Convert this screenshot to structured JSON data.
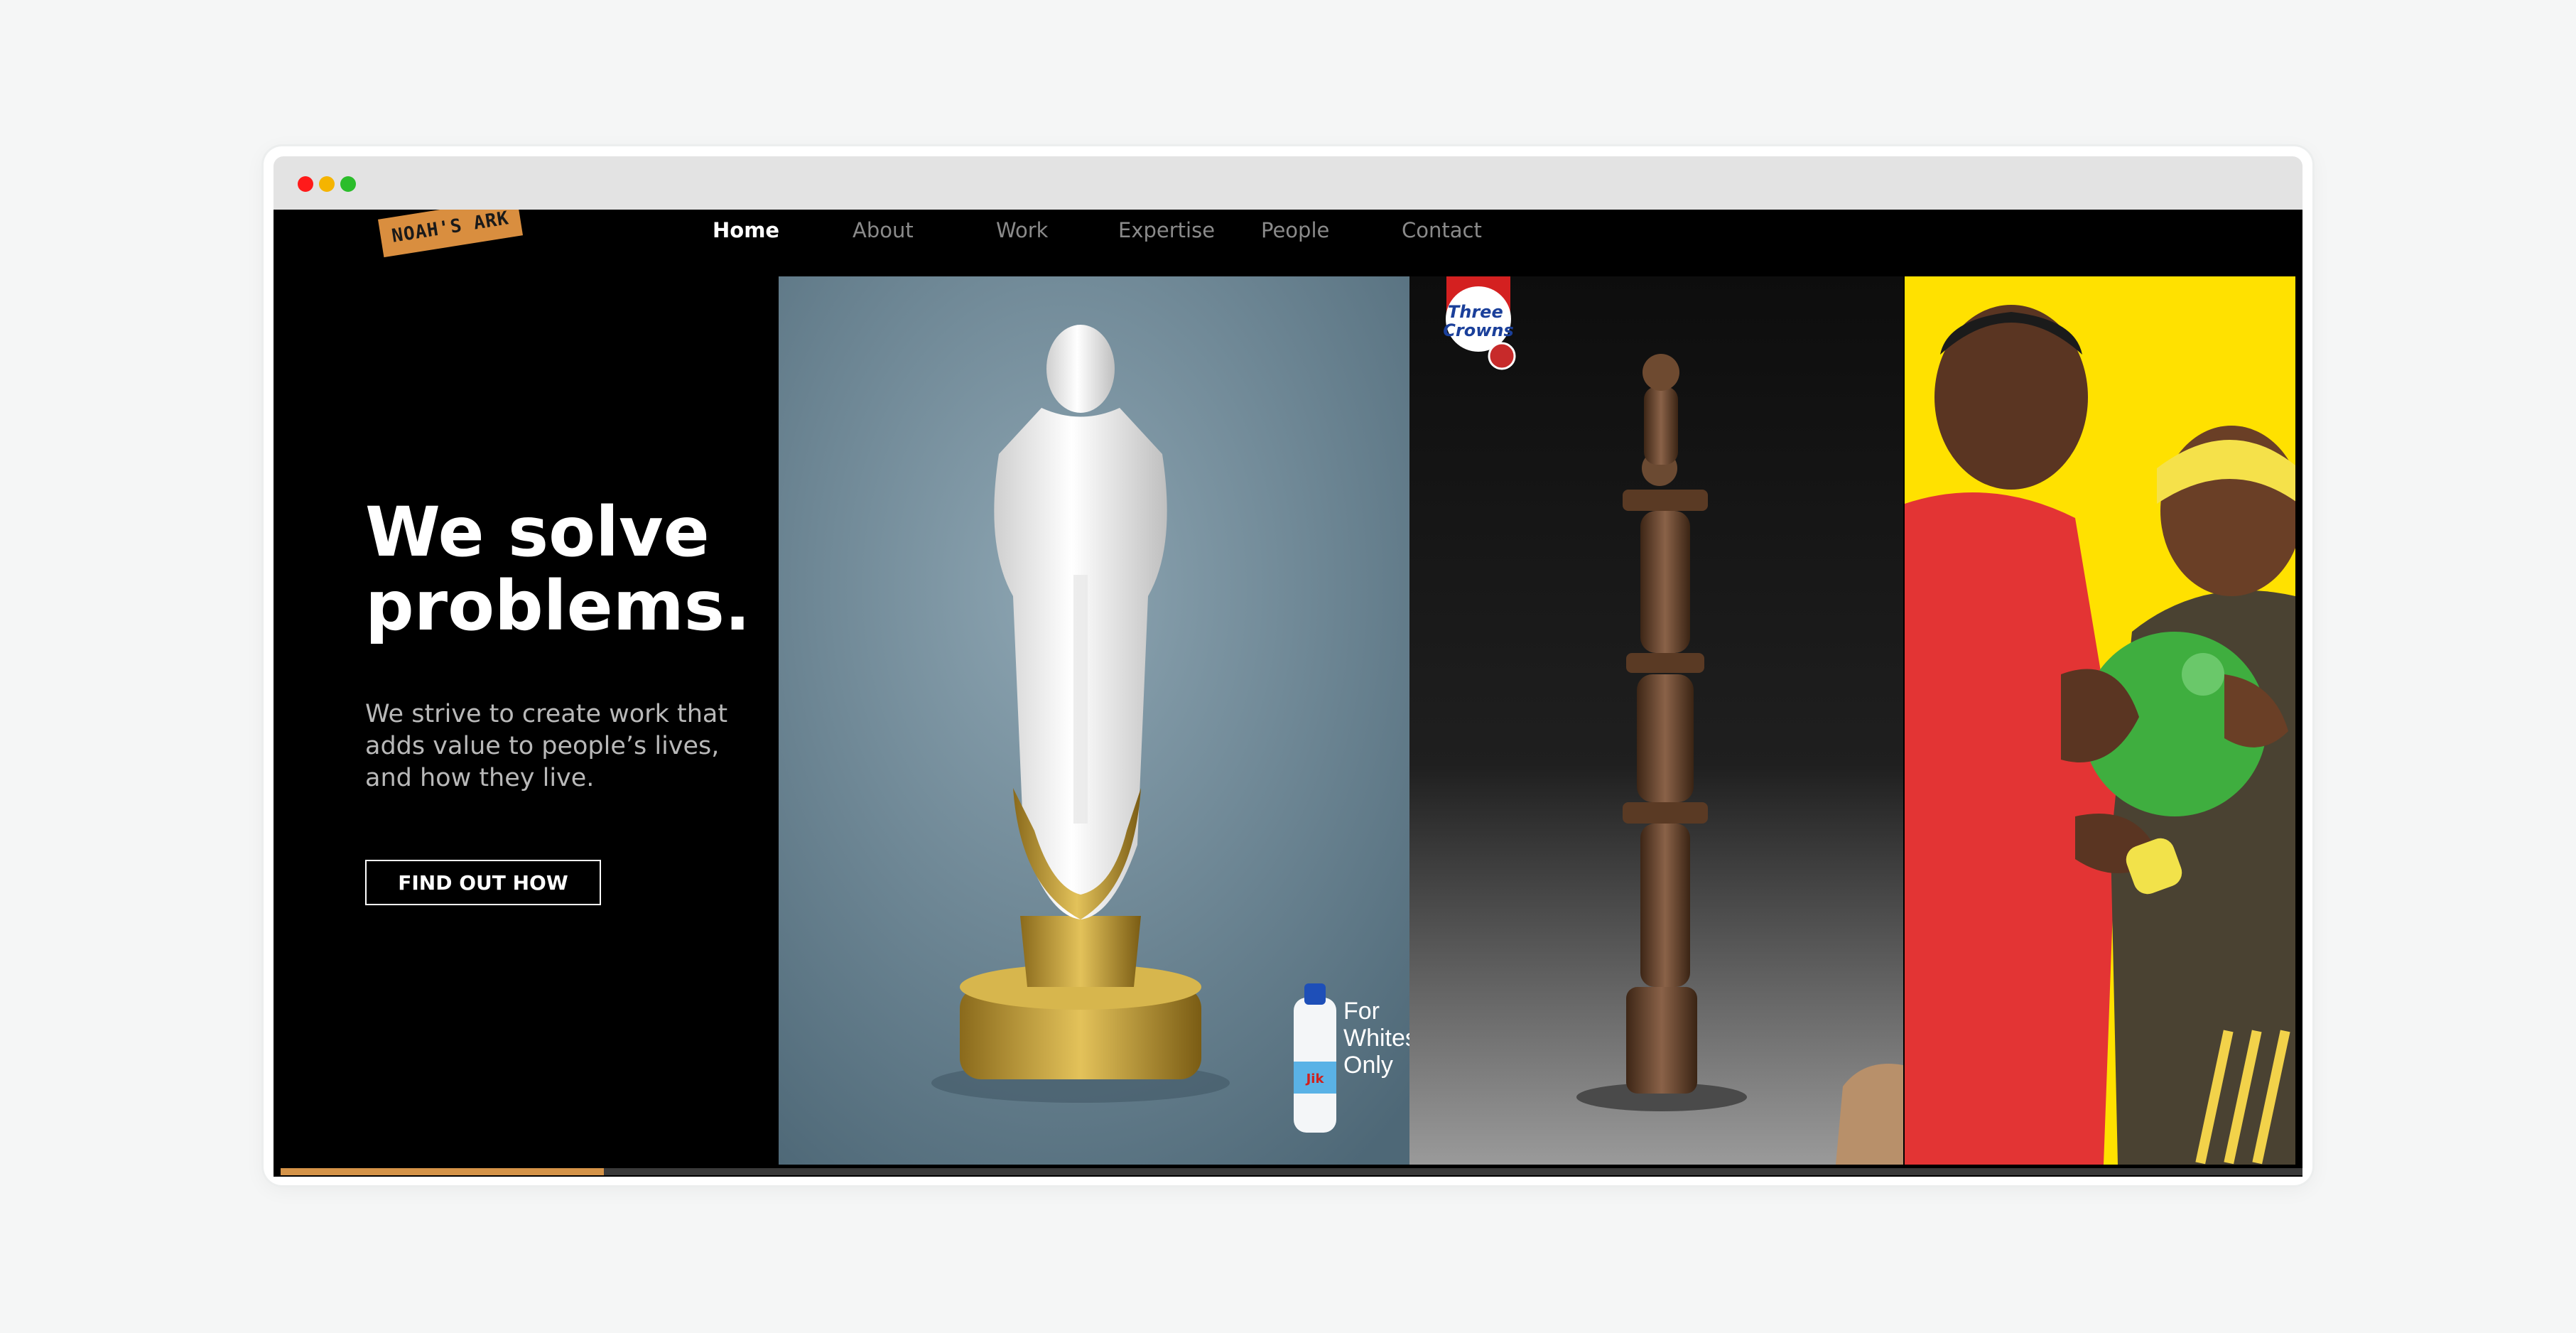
{
  "brand": {
    "logo_text": "NOAH'S ARK"
  },
  "nav": {
    "items": [
      {
        "label": "Home",
        "active": true
      },
      {
        "label": "About",
        "active": false
      },
      {
        "label": "Work",
        "active": false
      },
      {
        "label": "Expertise",
        "active": false
      },
      {
        "label": "People",
        "active": false
      },
      {
        "label": "Contact",
        "active": false
      }
    ]
  },
  "hero": {
    "title_line1": "We solve",
    "title_line2": "problems.",
    "text": "We strive to create work that adds value to people’s lives, and how they live.",
    "cta_label": "FIND OUT HOW"
  },
  "gallery": {
    "panels": [
      {
        "caption_lines": [
          "For",
          "Whites",
          "Only"
        ],
        "product_label": "Jik"
      },
      {
        "brand_lines": [
          "Three",
          "Crowns"
        ]
      },
      {}
    ]
  },
  "slider": {
    "progress": 0.16
  },
  "colors": {
    "accent": "#d49348",
    "background": "#000000",
    "yellow": "#ffe100",
    "red": "#e33434"
  }
}
